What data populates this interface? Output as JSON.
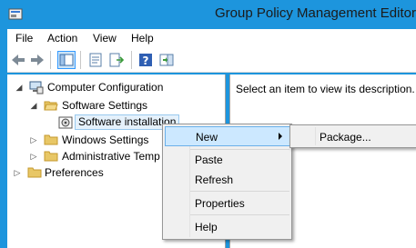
{
  "window": {
    "title": "Group Policy Management Editor"
  },
  "menubar": {
    "items": [
      "File",
      "Action",
      "View",
      "Help"
    ]
  },
  "toolbar": {
    "buttons": [
      "back-icon",
      "forward-icon",
      "show-hide-tree-icon",
      "properties-icon",
      "export-list-icon",
      "help-icon",
      "action-pane-icon"
    ]
  },
  "tree": {
    "computer_configuration": "Computer Configuration",
    "software_settings": "Software Settings",
    "software_installation": "Software installation",
    "windows_settings": "Windows Settings",
    "administrative_templates": "Administrative Temp",
    "preferences": "Preferences"
  },
  "details": {
    "description": "Select an item to view its description."
  },
  "context_menu": {
    "new": "New",
    "paste": "Paste",
    "refresh": "Refresh",
    "properties": "Properties",
    "help": "Help"
  },
  "submenu": {
    "package": "Package..."
  },
  "colors": {
    "title_bar": "#1d95dd",
    "menu_highlight": "#cce8ff",
    "folder": "#e8c766"
  }
}
